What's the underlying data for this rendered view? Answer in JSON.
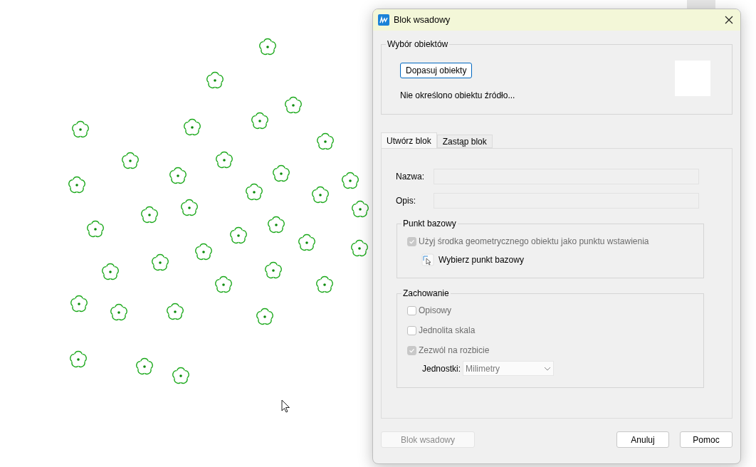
{
  "dialog": {
    "title": "Blok wsadowy"
  },
  "selection": {
    "legend": "Wybór obiektów",
    "button": "Dopasuj obiekty",
    "status": "Nie określono obiektu źródło..."
  },
  "tabs": [
    {
      "label": "Utwórz blok",
      "selected": true
    },
    {
      "label": "Zastąp blok",
      "selected": false
    }
  ],
  "fields": [
    {
      "label": "Nazwa:"
    },
    {
      "label": "Opis:"
    }
  ],
  "base_point": {
    "legend": "Punkt bazowy",
    "checkbox": {
      "label": "Użyj środka geometrycznego obiektu jako punktu wstawienia",
      "checked": true,
      "disabled": true
    },
    "pick_button": "Wybierz punkt bazowy"
  },
  "behavior": {
    "legend": "Zachowanie",
    "checkboxes": [
      {
        "label": "Opisowy",
        "checked": false,
        "disabled": true
      },
      {
        "label": "Jednolita skala",
        "checked": false,
        "disabled": true
      },
      {
        "label": "Zezwól na rozbicie",
        "checked": true,
        "disabled": true
      }
    ],
    "units": {
      "label": "Jednostki:",
      "value": "Milimetry",
      "disabled": true
    }
  },
  "buttons": [
    {
      "label": "Blok wsadowy",
      "disabled": true
    },
    {
      "label": "Anuluj",
      "disabled": false
    },
    {
      "label": "Pomoc",
      "disabled": false
    }
  ]
}
